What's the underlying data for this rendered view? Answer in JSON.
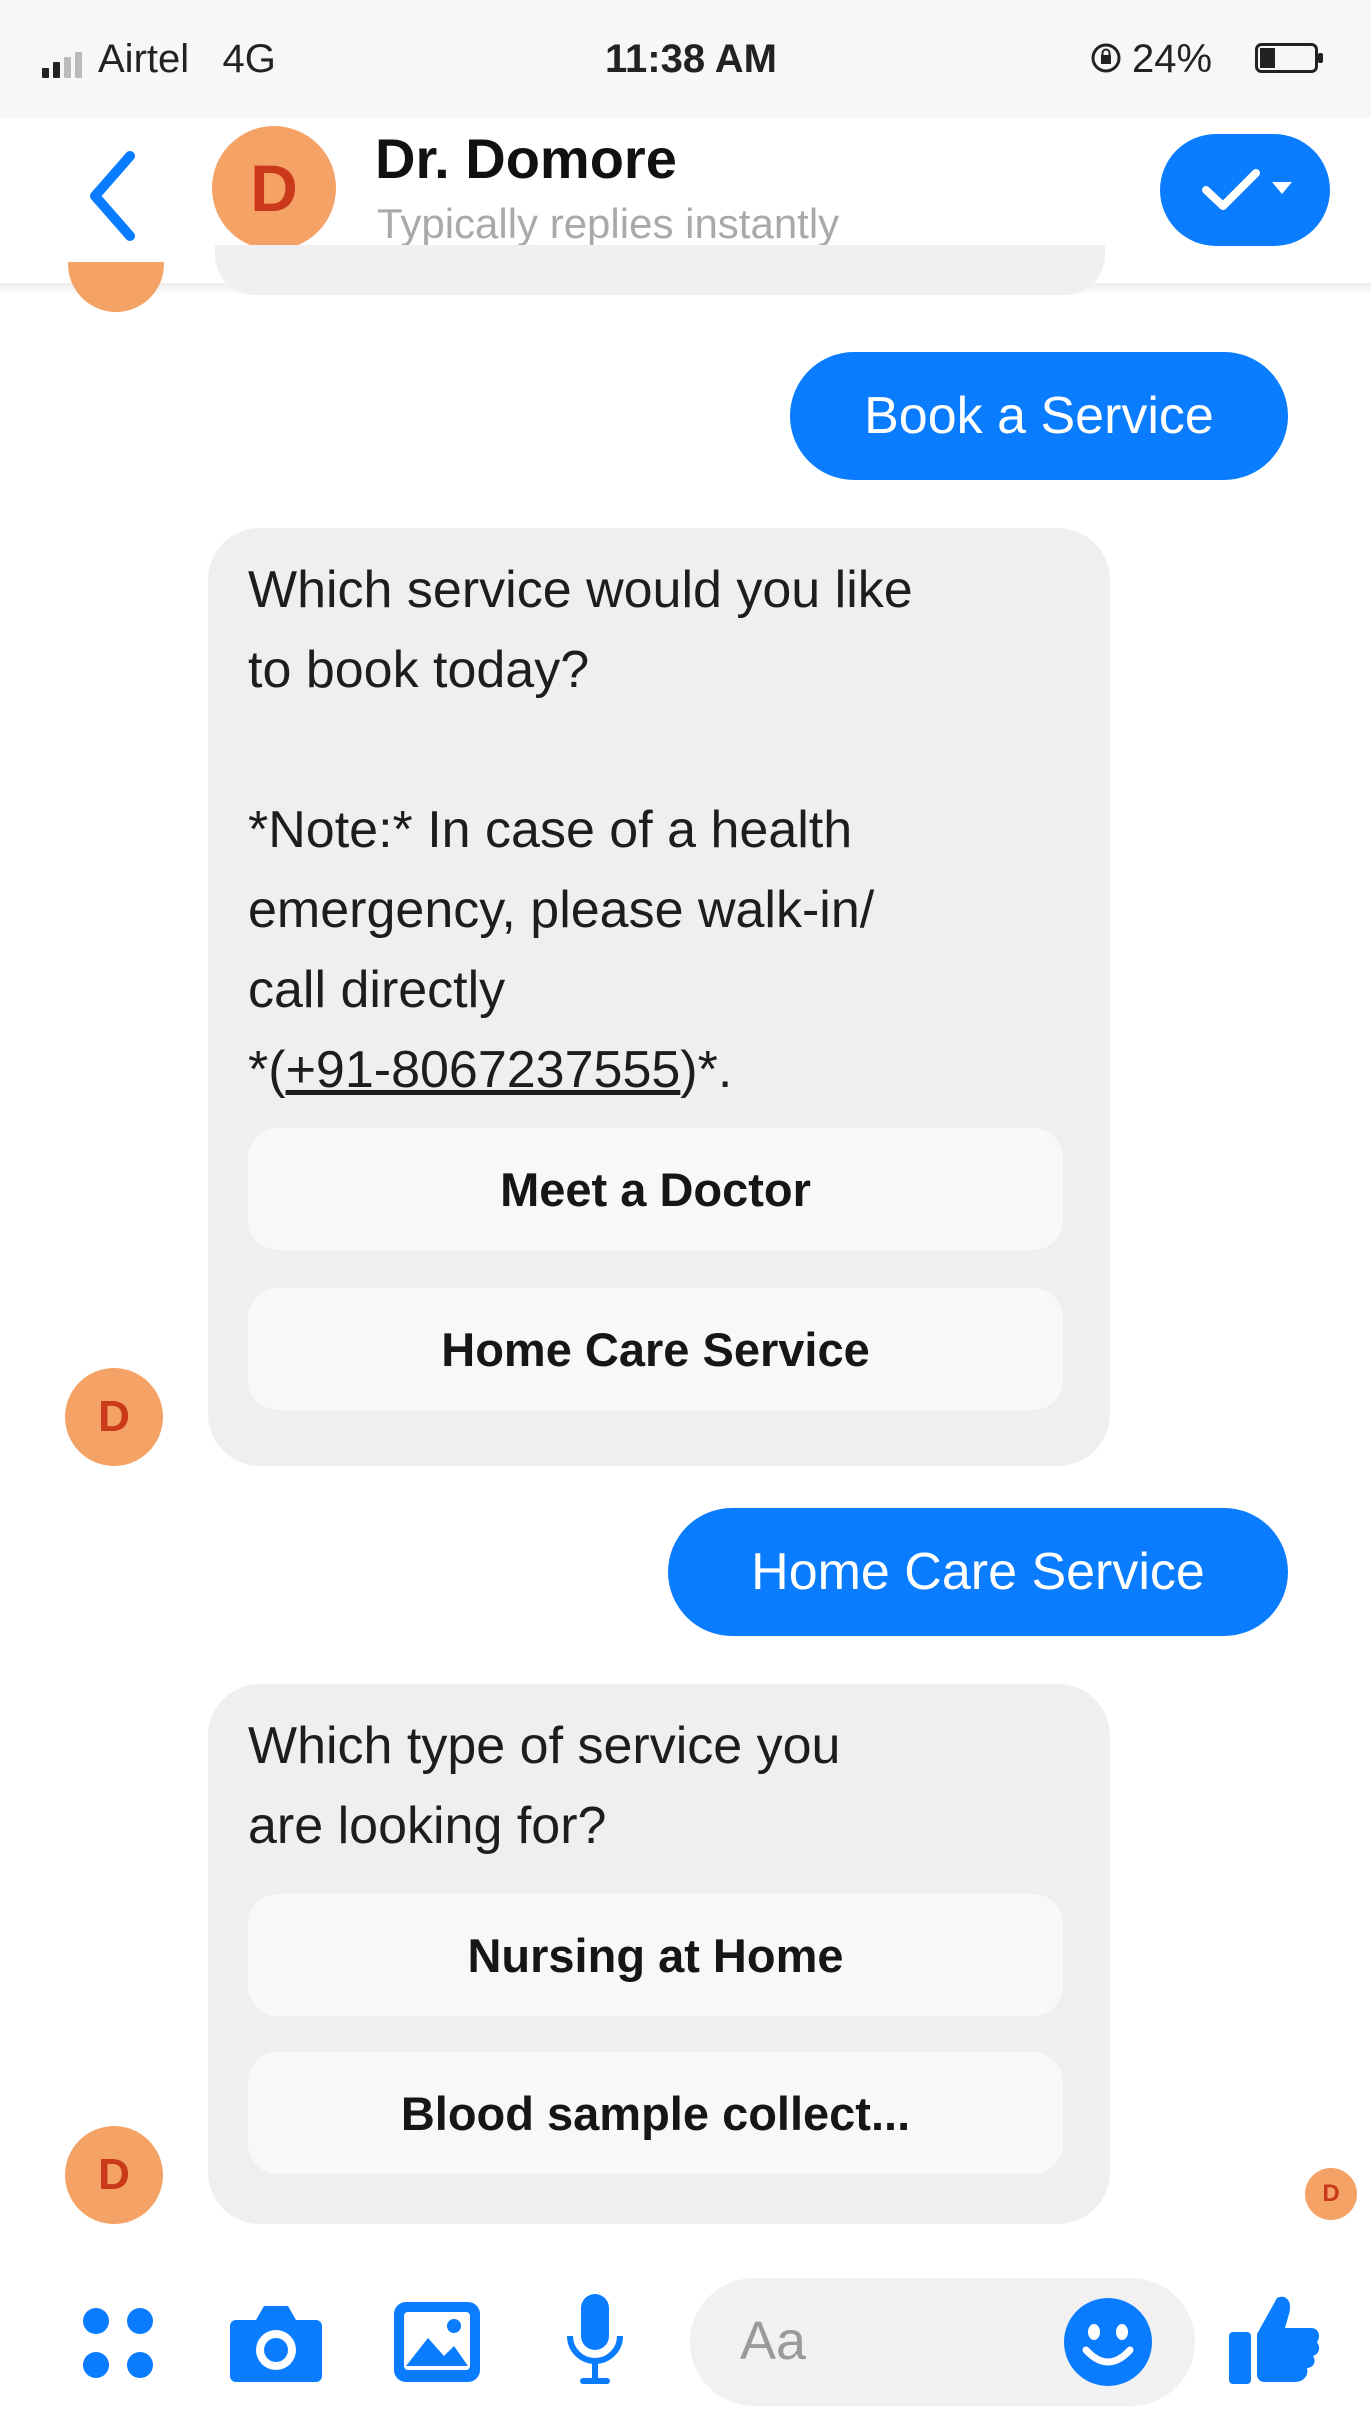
{
  "status_bar": {
    "carrier": "Airtel",
    "network": "4G",
    "time": "11:38 AM",
    "battery": "24%"
  },
  "header": {
    "avatar_letter": "D",
    "name": "Dr. Domore",
    "subtitle": "Typically replies instantly"
  },
  "messages": {
    "out_1": "Book a Service",
    "in_1": {
      "line1": "Which service would you like",
      "line2": "to book today?",
      "line3": "*Note:* In case of a health",
      "line4": "emergency, please walk-in/",
      "line5": "call directly",
      "line6_prefix": "*(",
      "phone": "+91-8067237555",
      "line6_suffix": ")*.",
      "replies": [
        "Meet a Doctor",
        "Home Care Service"
      ]
    },
    "out_2": "Home Care Service",
    "in_2": {
      "line1": "Which type of service you",
      "line2": "are looking for?",
      "replies": [
        "Nursing at Home",
        "Blood sample collect..."
      ]
    },
    "avatar_letter": "D",
    "seen_letter": "D"
  },
  "composer": {
    "placeholder": "Aa"
  },
  "colors": {
    "accent": "#0a7cff",
    "avatar": "#f4a266",
    "avatar_letter": "#c9391a",
    "bubble_in": "#efefef",
    "icon_blue": "#0a7cff"
  },
  "icons": [
    "back-chevron-icon",
    "checkmark-icon",
    "dropdown-icon",
    "signal-icon",
    "battery-icon",
    "orientation-lock-icon",
    "apps-grid-icon",
    "camera-icon",
    "image-icon",
    "microphone-icon",
    "emoji-icon",
    "thumbs-up-icon"
  ]
}
